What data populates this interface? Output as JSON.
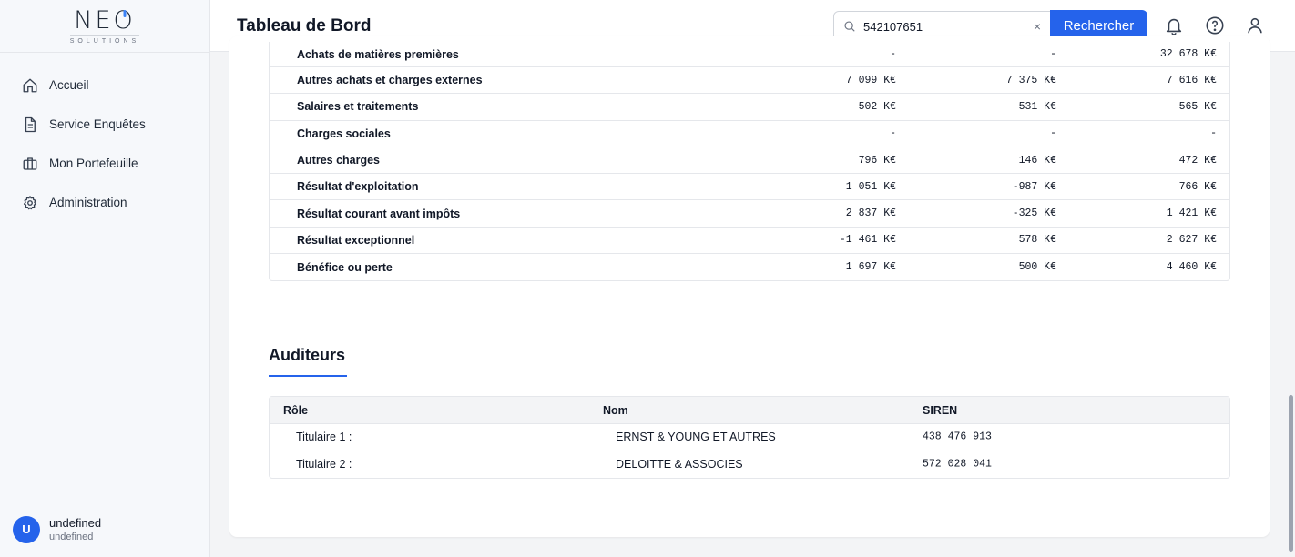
{
  "brand": {
    "name": "NEO",
    "tagline": "SOLUTIONS"
  },
  "sidebar": {
    "items": [
      {
        "label": "Accueil",
        "icon": "home-icon"
      },
      {
        "label": "Service Enquêtes",
        "icon": "document-icon"
      },
      {
        "label": "Mon Portefeuille",
        "icon": "briefcase-icon"
      },
      {
        "label": "Administration",
        "icon": "gear-icon"
      }
    ],
    "user": {
      "initial": "U",
      "name": "undefined",
      "sub": "undefined"
    }
  },
  "header": {
    "title": "Tableau de Bord",
    "search_value": "542107651",
    "clear_label": "×",
    "search_button": "Rechercher"
  },
  "financials": {
    "rows": [
      {
        "label": "Achats de matières premières",
        "v1": "-",
        "v2": "-",
        "v3": "32 678 K€"
      },
      {
        "label": "Autres achats et charges externes",
        "v1": "7 099 K€",
        "v2": "7 375 K€",
        "v3": "7 616 K€"
      },
      {
        "label": "Salaires et traitements",
        "v1": "502 K€",
        "v2": "531 K€",
        "v3": "565 K€"
      },
      {
        "label": "Charges sociales",
        "v1": "-",
        "v2": "-",
        "v3": "-"
      },
      {
        "label": "Autres charges",
        "v1": "796 K€",
        "v2": "146 K€",
        "v3": "472 K€"
      },
      {
        "label": "Résultat d'exploitation",
        "v1": "1 051 K€",
        "v2": "-987 K€",
        "v3": "766 K€"
      },
      {
        "label": "Résultat courant avant impôts",
        "v1": "2 837 K€",
        "v2": "-325 K€",
        "v3": "1 421 K€"
      },
      {
        "label": "Résultat exceptionnel",
        "v1": "-1 461 K€",
        "v2": "578 K€",
        "v3": "2 627 K€"
      },
      {
        "label": "Bénéfice ou perte",
        "v1": "1 697 K€",
        "v2": "500 K€",
        "v3": "4 460 K€"
      }
    ]
  },
  "auditors": {
    "title": "Auditeurs",
    "headers": {
      "role": "Rôle",
      "name": "Nom",
      "siren": "SIREN"
    },
    "rows": [
      {
        "role": "Titulaire 1 :",
        "name": "ERNST & YOUNG ET AUTRES",
        "siren": "438 476 913"
      },
      {
        "role": "Titulaire 2 :",
        "name": "DELOITTE & ASSOCIES",
        "siren": "572 028 041"
      }
    ]
  },
  "colors": {
    "accent": "#2563eb",
    "border": "#e5e7eb",
    "sidebar_bg": "#f6f8fb"
  }
}
